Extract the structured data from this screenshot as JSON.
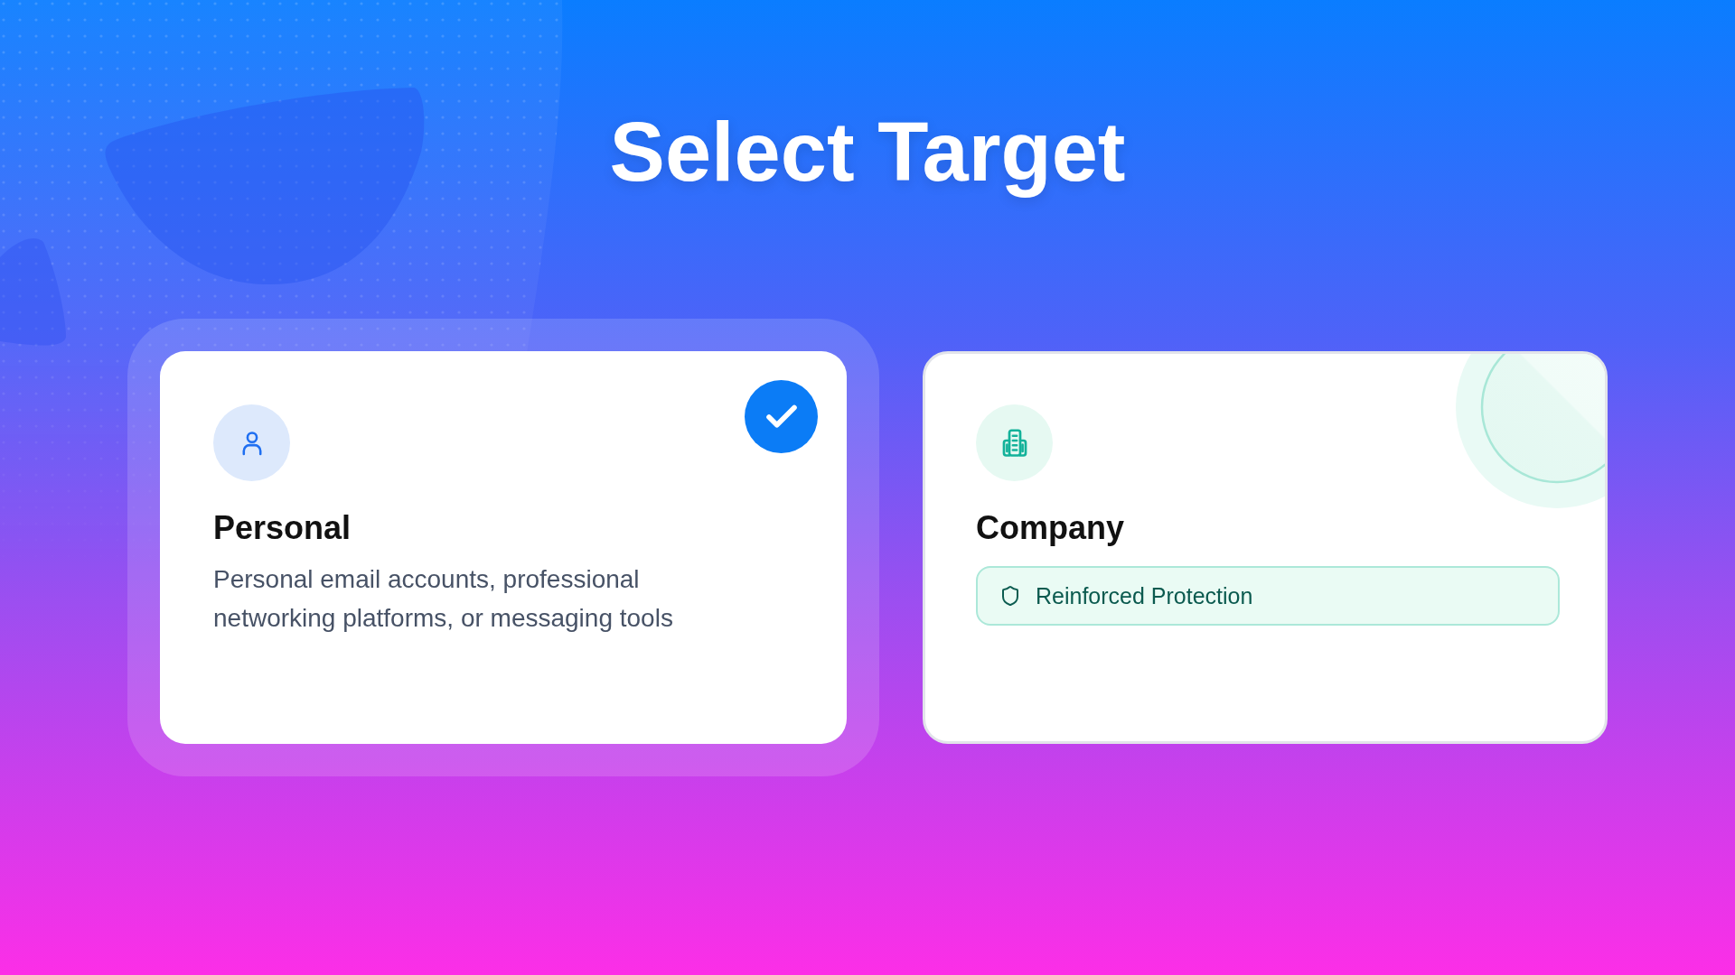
{
  "title": "Select Target",
  "options": [
    {
      "kind": "personal",
      "title": "Personal",
      "description": "Personal email accounts, professional networking platforms, or messaging tools",
      "selected": true
    },
    {
      "kind": "company",
      "title": "Company",
      "badge": "Reinforced Protection",
      "selected": false
    }
  ]
}
